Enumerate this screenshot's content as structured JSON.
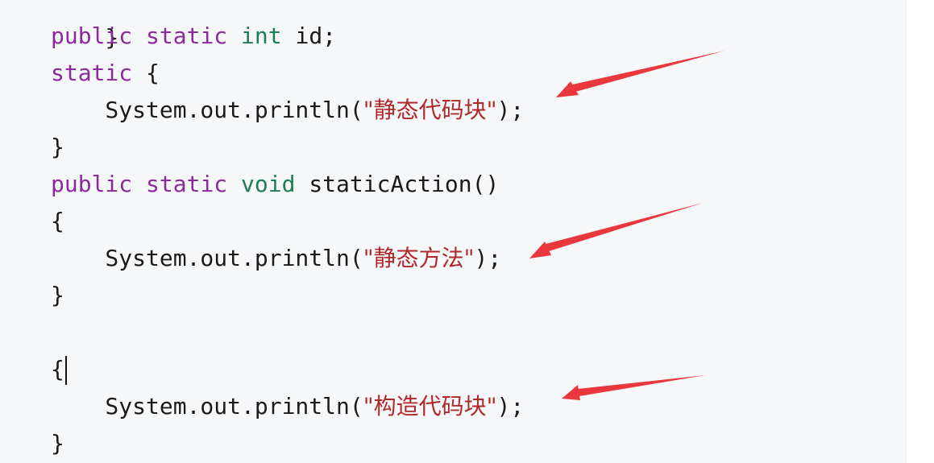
{
  "code": {
    "line0_text": "}",
    "line1": {
      "kw1": "public",
      "kw2": "static",
      "type": "int",
      "rest": " id;"
    },
    "line2": {
      "kw": "static",
      "rest": " {"
    },
    "line3": {
      "prefix": "    System.out.println(",
      "str": "\"静态代码块\"",
      "suffix": ");"
    },
    "line4_text": "}",
    "line5": {
      "kw1": "public",
      "kw2": "static",
      "type": "void",
      "rest": " staticAction()"
    },
    "line6_text": "{",
    "line7": {
      "prefix": "    System.out.println(",
      "str": "\"静态方法\"",
      "suffix": ");"
    },
    "line8_text": "}",
    "line9_text": "{",
    "line10": {
      "prefix": "    System.out.println(",
      "str": "\"构造代码块\"",
      "suffix": ");"
    },
    "line11_text": "}"
  },
  "colors": {
    "keyword": "#8a2a9b",
    "type": "#1d7d53",
    "string": "#b0282b",
    "arrow": "#e8383d",
    "background": "#f6f7f9"
  }
}
